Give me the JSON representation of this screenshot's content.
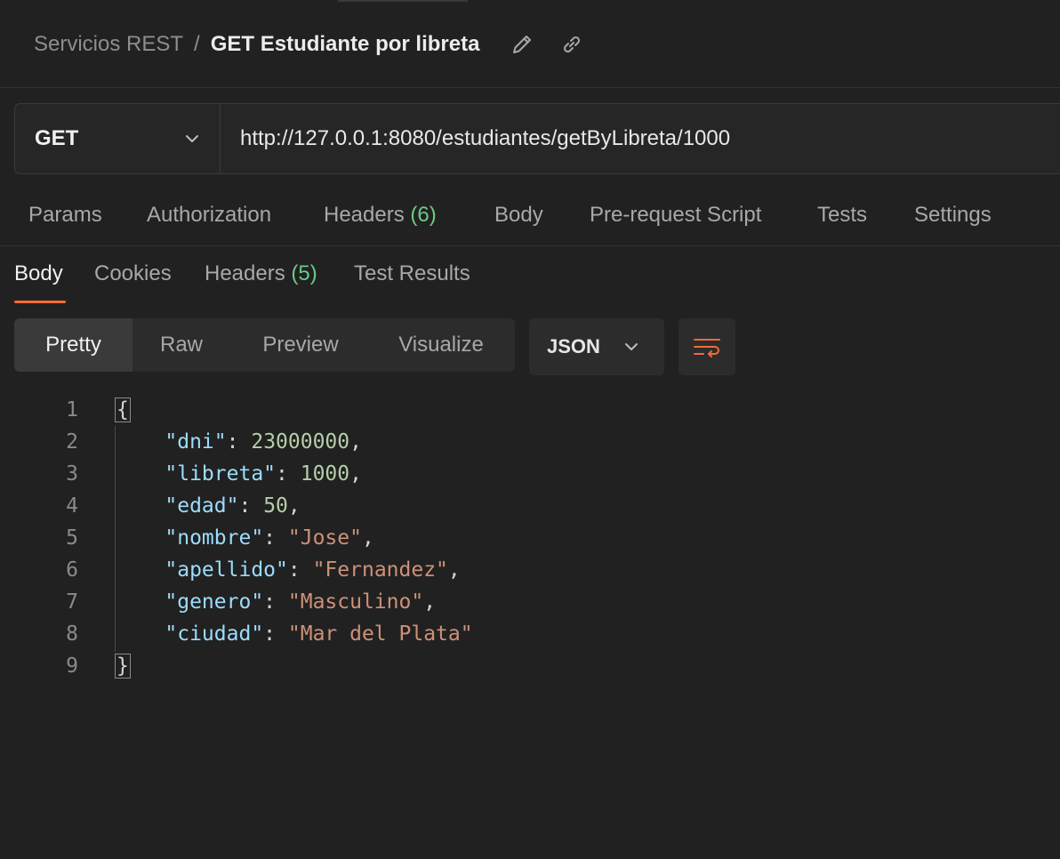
{
  "header": {
    "parent": "Servicios REST",
    "separator": "/",
    "title": "GET Estudiante por libreta"
  },
  "request": {
    "method": "GET",
    "url": "http://127.0.0.1:8080/estudiantes/getByLibreta/1000"
  },
  "request_tabs": [
    {
      "label": "Params"
    },
    {
      "label": "Authorization"
    },
    {
      "label": "Headers",
      "count": "(6)"
    },
    {
      "label": "Body"
    },
    {
      "label": "Pre-request Script"
    },
    {
      "label": "Tests"
    },
    {
      "label": "Settings"
    }
  ],
  "response_tabs": [
    {
      "label": "Body"
    },
    {
      "label": "Cookies"
    },
    {
      "label": "Headers",
      "count": "(5)"
    },
    {
      "label": "Test Results"
    }
  ],
  "view_modes": [
    "Pretty",
    "Raw",
    "Preview",
    "Visualize"
  ],
  "format": "JSON",
  "line_numbers": [
    "1",
    "2",
    "3",
    "4",
    "5",
    "6",
    "7",
    "8",
    "9"
  ],
  "json": {
    "open": "{",
    "close": "}",
    "fields": [
      {
        "key": "\"dni\"",
        "value": "23000000",
        "comma": ","
      },
      {
        "key": "\"libreta\"",
        "value": "1000",
        "comma": ","
      },
      {
        "key": "\"edad\"",
        "value": "50",
        "comma": ","
      },
      {
        "key": "\"nombre\"",
        "value": "\"Jose\"",
        "comma": ","
      },
      {
        "key": "\"apellido\"",
        "value": "\"Fernandez\"",
        "comma": ","
      },
      {
        "key": "\"genero\"",
        "value": "\"Masculino\"",
        "comma": ","
      },
      {
        "key": "\"ciudad\"",
        "value": "\"Mar del Plata\"",
        "comma": ""
      }
    ]
  },
  "colors": {
    "accent": "#f26b3a",
    "count_green": "#6bc986",
    "json_key": "#9cdcfe",
    "json_number": "#b5cea8",
    "json_string": "#ce9178"
  },
  "icons": [
    "pencil-icon",
    "link-icon",
    "chevron-down-icon",
    "wrap-lines-icon"
  ]
}
